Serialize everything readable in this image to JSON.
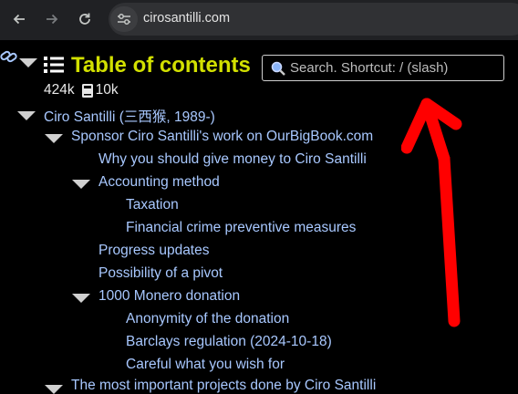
{
  "browser": {
    "url": "cirosantilli.com",
    "icons": [
      "back-icon",
      "forward-icon",
      "reload-icon",
      "site-info-icon"
    ]
  },
  "toc": {
    "title": "Table of contents",
    "search_placeholder": "Search. Shortcut: / (slash)",
    "stats": {
      "words": "424k",
      "articles": "10k"
    },
    "items": [
      "Ciro Santilli (三西猴, 1989-)",
      "Sponsor Ciro Santilli's work on OurBigBook.com",
      "Why you should give money to Ciro Santilli",
      "Accounting method",
      "Taxation",
      "Financial crime preventive measures",
      "Progress updates",
      "Possibility of a pivot",
      "1000 Monero donation",
      "Anonymity of the donation",
      "Barclays regulation (2024-10-18)",
      "Careful what you wish for",
      "The most important projects done by Ciro Santilli"
    ]
  },
  "annotation": {
    "color": "#ff0000",
    "shape": "arrow pointing up at search box"
  }
}
